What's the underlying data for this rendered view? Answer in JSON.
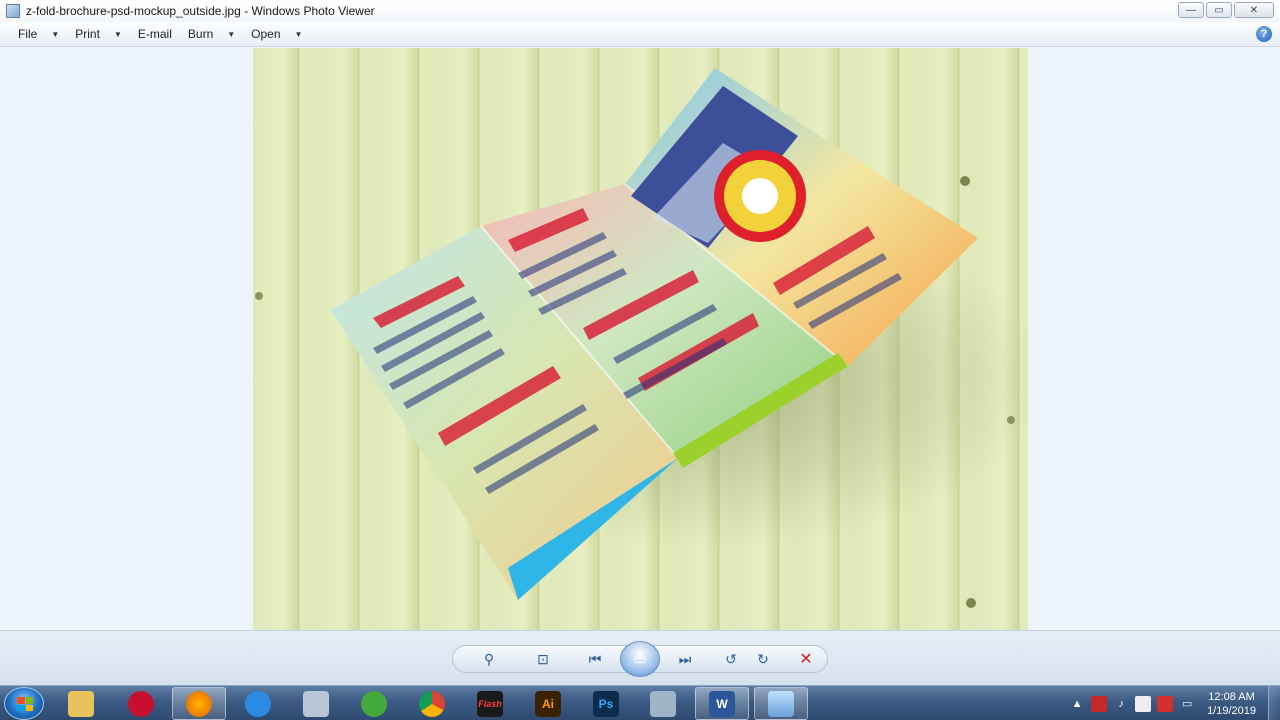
{
  "window": {
    "title": "z-fold-brochure-psd-mockup_outside.jpg - Windows Photo Viewer",
    "minimize_glyph": "—",
    "maximize_glyph": "▭",
    "close_glyph": "✕"
  },
  "menu": {
    "items": [
      {
        "label": "File",
        "has_dropdown": true
      },
      {
        "label": "Print",
        "has_dropdown": true
      },
      {
        "label": "E-mail",
        "has_dropdown": false
      },
      {
        "label": "Burn",
        "has_dropdown": true
      },
      {
        "label": "Open",
        "has_dropdown": true
      }
    ],
    "help_glyph": "?"
  },
  "toolbar": {
    "zoom_glyph": "⚲",
    "actual_size_glyph": "⊡",
    "previous_glyph": "⏮",
    "slideshow_glyph": "▭",
    "next_glyph": "⏭",
    "rotate_ccw_glyph": "↺",
    "rotate_cw_glyph": "↻",
    "delete_glyph": "✕"
  },
  "taskbar": {
    "apps": [
      {
        "name": "windows-explorer",
        "icon": "folder-icon",
        "label": "",
        "color": "#e8c25a"
      },
      {
        "name": "app-red",
        "icon": "red-gear-icon",
        "label": "",
        "color": "#c8102e"
      },
      {
        "name": "firefox",
        "icon": "firefox-icon",
        "label": "",
        "color": "#e66000"
      },
      {
        "name": "app-blue",
        "icon": "lightning-icon",
        "label": "",
        "color": "#2a8be0"
      },
      {
        "name": "app-tool",
        "icon": "scissors-icon",
        "label": "",
        "color": "#b9c6d6"
      },
      {
        "name": "app-green",
        "icon": "green-app-icon",
        "label": "",
        "color": "#45a83b"
      },
      {
        "name": "chrome",
        "icon": "chrome-icon",
        "label": "",
        "color": "#db4437"
      },
      {
        "name": "flash",
        "icon": "flash-icon",
        "label": "Flash",
        "color": "#1a1a1a"
      },
      {
        "name": "illustrator",
        "icon": "illustrator-icon",
        "label": "Ai",
        "color": "#3a2200"
      },
      {
        "name": "photoshop",
        "icon": "photoshop-icon",
        "label": "Ps",
        "color": "#0b2c4a"
      },
      {
        "name": "app-doc",
        "icon": "document-icon",
        "label": "",
        "color": "#9fb4c8"
      },
      {
        "name": "word",
        "icon": "word-icon",
        "label": "W",
        "color": "#2b579a"
      },
      {
        "name": "photo-viewer",
        "icon": "photo-viewer-icon",
        "label": "",
        "color": "#6aa0d8"
      }
    ],
    "tray": {
      "clock_time": "12:08 AM",
      "clock_date": "1/19/2019"
    }
  }
}
